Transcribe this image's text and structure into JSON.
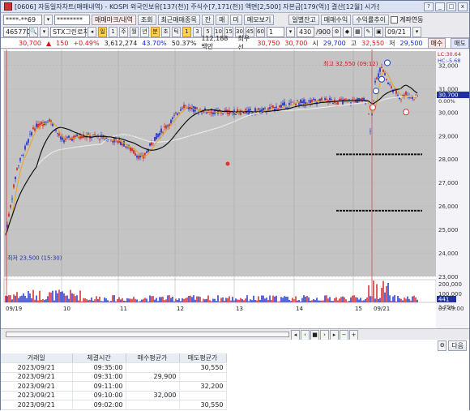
{
  "window": {
    "title": "[0606] 자동일자차트(매매내역) - KOSPI 외국인보유[137(천)] 주식수[7,171(천)] 액면[2,500] 자본금[179(억)] 결산[12월] 시가총액[2,198(억)]",
    "buttons": [
      "?",
      "_",
      "□",
      "x"
    ]
  },
  "toolbar1": {
    "account": "****-**69",
    "password": "********",
    "trade_label": "매매마크/내역",
    "lookup": "조회",
    "recent": "최근매매종목",
    "jan": "잔",
    "mae": "매",
    "mi": "미",
    "memo": "메모보기",
    "daily_balance": "일별잔고",
    "trade_profit": "매매수익",
    "profit_trend": "수익률추이",
    "sync_label": "계좌연동"
  },
  "toolbar2": {
    "code": "465770",
    "name": "STX그린로지",
    "periods": [
      "일",
      "1",
      "주",
      "월",
      "년",
      "분",
      "초",
      "틱"
    ],
    "intervals": [
      "1",
      "3",
      "5",
      "10",
      "15",
      "30",
      "45",
      "60"
    ],
    "count": "1",
    "range": "430",
    "range_total": "/900",
    "date": "09/21"
  },
  "quote": {
    "price": "30,700",
    "change": "150",
    "rate": "+0.49%",
    "volume": "3,612,274",
    "vol_rate": "43.70%",
    "turnover": "50.37%",
    "amount": "112,188백만",
    "best_buy_label": "최우선",
    "best_sell": "30,750",
    "best_buy": "30,700",
    "low_label": "시",
    "open": "29,700",
    "high_label": "고",
    "high": "32,550",
    "low_label2": "저",
    "low": "29,500",
    "buy_btn": "매수",
    "sell_btn": "매도"
  },
  "chart_labels": {
    "high_note": "최고 32,550 (09:12)",
    "low_note": "최저 23,500 (15:30)",
    "lc": "LC:30.64",
    "hc": "HC:-5.68",
    "cur_price": "30,700",
    "cur_rate": "0.00%",
    "vol_pct": "3.75%",
    "vol_now": "441",
    "time_end": "09:49:00",
    "price_ticks": [
      "32,000",
      "31,000",
      "30,000",
      "29,000",
      "28,000",
      "27,000",
      "26,000",
      "25,000",
      "24,000",
      "23,000"
    ],
    "vol_ticks": [
      "200,000",
      "100,000"
    ],
    "date_ticks": [
      "09/19",
      "10",
      "11",
      "12",
      "13",
      "14",
      "15",
      "09/21"
    ]
  },
  "trades": {
    "headers": [
      "거래일",
      "체결시간",
      "매수평균가",
      "매도평균가"
    ],
    "rows": [
      [
        "2023/09/21",
        "09:35:00",
        "",
        "30,550"
      ],
      [
        "2023/09/21",
        "09:31:00",
        "29,900",
        ""
      ],
      [
        "2023/09/21",
        "09:11:00",
        "",
        "32,200"
      ],
      [
        "2023/09/21",
        "09:10:00",
        "32,000",
        ""
      ],
      [
        "2023/09/21",
        "09:02:00",
        "",
        "30,550"
      ]
    ]
  },
  "bottom_btn": "다음",
  "colors": {
    "up": "#d01818",
    "down": "#1428c8",
    "ma_long": "#111111",
    "ma_mid": "#f0a020",
    "ma_short": "#e8e8e8"
  }
}
